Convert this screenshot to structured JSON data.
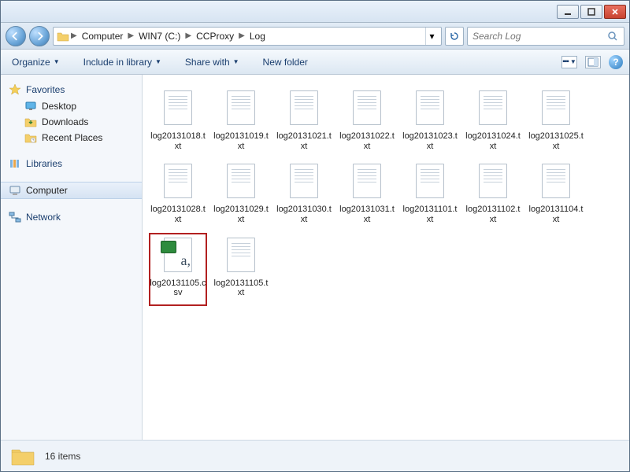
{
  "breadcrumb": [
    "Computer",
    "WIN7 (C:)",
    "CCProxy",
    "Log"
  ],
  "search": {
    "placeholder": "Search Log"
  },
  "toolbar": {
    "organize": "Organize",
    "include": "Include in library",
    "share": "Share with",
    "newfolder": "New folder"
  },
  "sidebar": {
    "favorites": "Favorites",
    "favorites_items": [
      "Desktop",
      "Downloads",
      "Recent Places"
    ],
    "libraries": "Libraries",
    "computer": "Computer",
    "network": "Network"
  },
  "files": [
    {
      "name": "log20131018.txt",
      "type": "txt"
    },
    {
      "name": "log20131019.txt",
      "type": "txt"
    },
    {
      "name": "log20131021.txt",
      "type": "txt"
    },
    {
      "name": "log20131022.txt",
      "type": "txt"
    },
    {
      "name": "log20131023.txt",
      "type": "txt"
    },
    {
      "name": "log20131024.txt",
      "type": "txt"
    },
    {
      "name": "log20131025.txt",
      "type": "txt"
    },
    {
      "name": "log20131028.txt",
      "type": "txt"
    },
    {
      "name": "log20131029.txt",
      "type": "txt"
    },
    {
      "name": "log20131030.txt",
      "type": "txt"
    },
    {
      "name": "log20131031.txt",
      "type": "txt"
    },
    {
      "name": "log20131101.txt",
      "type": "txt"
    },
    {
      "name": "log20131102.txt",
      "type": "txt"
    },
    {
      "name": "log20131104.txt",
      "type": "txt"
    },
    {
      "name": "log20131105.csv",
      "type": "csv",
      "highlight": true
    },
    {
      "name": "log20131105.txt",
      "type": "txt"
    }
  ],
  "status": {
    "count_label": "16 items"
  }
}
